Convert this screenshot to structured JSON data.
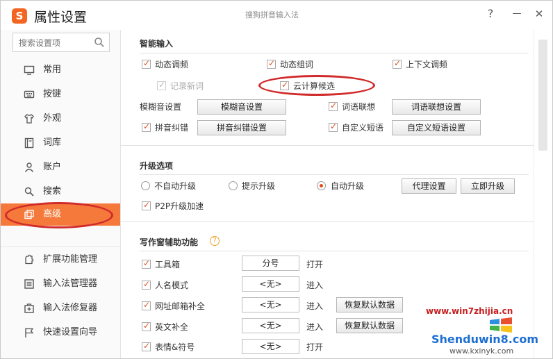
{
  "window": {
    "logo_glyph": "S",
    "title": "属性设置",
    "subtitle": "搜狗拼音输入法",
    "help_label": "?",
    "minimize_label": "—",
    "close_label": "✕"
  },
  "sidebar": {
    "search_placeholder": "搜索设置项",
    "items": [
      {
        "label": "常用",
        "icon": "monitor-icon"
      },
      {
        "label": "按键",
        "icon": "keyboard-icon"
      },
      {
        "label": "外观",
        "icon": "tshirt-icon"
      },
      {
        "label": "词库",
        "icon": "book-icon"
      },
      {
        "label": "账户",
        "icon": "user-icon"
      },
      {
        "label": "搜索",
        "icon": "search-icon"
      },
      {
        "label": "高级",
        "icon": "advanced-icon",
        "active": true
      }
    ],
    "tools": [
      {
        "label": "扩展功能管理",
        "icon": "puzzle-icon"
      },
      {
        "label": "输入法管理器",
        "icon": "list-icon"
      },
      {
        "label": "输入法修复器",
        "icon": "repair-icon"
      },
      {
        "label": "快速设置向导",
        "icon": "flag-icon"
      }
    ]
  },
  "smart_input": {
    "title": "智能输入",
    "dynamic_freq": "动态调频",
    "dynamic_phrase": "动态组词",
    "context_freq": "上下文调频",
    "record_new_words": "记录新词",
    "cloud_candidate": "云计算候选",
    "fuzzy_label": "模糊音设置",
    "fuzzy_button": "模糊音设置",
    "association": "词语联想",
    "association_button": "词语联想设置",
    "pinyin_correction": "拼音纠错",
    "correction_button": "拼音纠错设置",
    "custom_phrase": "自定义短语",
    "custom_phrase_button": "自定义短语设置"
  },
  "upgrade": {
    "title": "升级选项",
    "options": [
      "不自动升级",
      "提示升级",
      "自动升级"
    ],
    "selected": "自动升级",
    "proxy_button": "代理设置",
    "upgrade_now_button": "立即升级",
    "p2p": "P2P升级加速"
  },
  "writing": {
    "title": "写作窗辅助功能",
    "help_glyph": "?",
    "rows": [
      {
        "label": "工具箱",
        "value": "分号",
        "action": "打开",
        "restore": ""
      },
      {
        "label": "人名模式",
        "value": "<无>",
        "action": "进入",
        "restore": ""
      },
      {
        "label": "网址邮箱补全",
        "value": "<无>",
        "action": "进入",
        "restore": "恢复默认数据"
      },
      {
        "label": "英文补全",
        "value": "<无>",
        "action": "进入",
        "restore": "恢复默认数据"
      },
      {
        "label": "表情&符号",
        "value": "<无>",
        "action": "打开",
        "restore": ""
      }
    ]
  },
  "watermark": {
    "top": "www.win7zhijia.cn",
    "middle": "Shenduwin8.com",
    "bottom": "www.kxinyk.com"
  },
  "colors": {
    "accent": "#f5793b",
    "checkmark": "#e24d1b",
    "annotation_oval": "#d12a2a"
  }
}
